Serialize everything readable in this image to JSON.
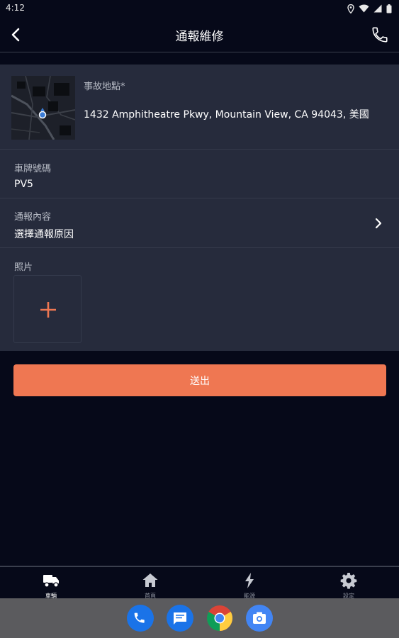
{
  "status_bar": {
    "time": "4:12",
    "icons": [
      "location-icon",
      "wifi-icon",
      "cellular-icon",
      "battery-icon"
    ]
  },
  "app_bar": {
    "title": "通報維修",
    "back_icon": "back-arrow-icon",
    "phone_icon": "phone-icon"
  },
  "form": {
    "location": {
      "label": "事故地點*",
      "value": "1432 Amphitheatre Pkwy, Mountain View, CA 94043, 美國"
    },
    "plate": {
      "label": "車牌號碼",
      "value": "PV5"
    },
    "report": {
      "label": "通報內容",
      "placeholder": "選擇通報原因"
    },
    "photo": {
      "label": "照片",
      "add_icon": "plus-icon"
    }
  },
  "submit_label": "送出",
  "bottom_nav": {
    "items": [
      {
        "label": "車輛",
        "icon": "scooter-truck-icon",
        "active": true
      },
      {
        "label": "首頁",
        "icon": "home-icon",
        "active": false
      },
      {
        "label": "能源",
        "icon": "lightning-icon",
        "active": false
      },
      {
        "label": "設定",
        "icon": "gear-icon",
        "active": false
      }
    ]
  },
  "dock": {
    "apps": [
      "phone-app-icon",
      "messages-app-icon",
      "chrome-app-icon",
      "camera-app-icon"
    ]
  },
  "colors": {
    "background": "#060919",
    "card": "#262b3c",
    "accent": "#ef7752"
  }
}
